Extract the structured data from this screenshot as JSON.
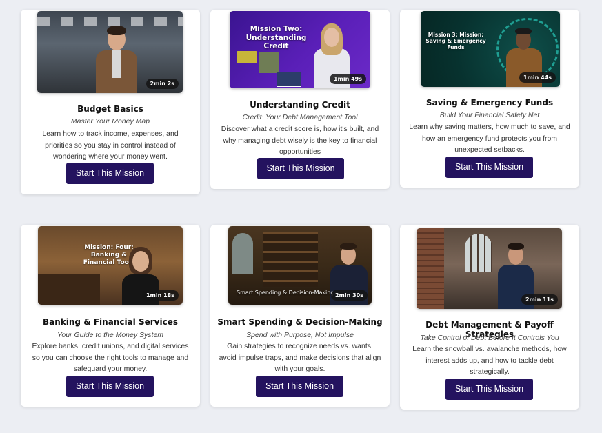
{
  "missions": [
    {
      "title": "Budget Basics",
      "subtitle": "Master Your Money Map",
      "description": "Learn how to track income, expenses, and priorities so you stay in control instead of wondering where your money went.",
      "duration": "2min 2s",
      "overlay": "",
      "button": "Start This Mission"
    },
    {
      "title": "Understanding Credit",
      "subtitle": "Credit: Your Debt Management Tool",
      "description": "Discover what a credit score is, how it's built, and why managing debt wisely is the key to financial opportunities",
      "duration": "1min 49s",
      "overlay": "Mission Two: Understanding Credit",
      "button": "Start This Mission"
    },
    {
      "title": "Saving & Emergency Funds",
      "subtitle": "Build Your Financial Safety Net",
      "description": "Learn why saving matters, how much to save, and how an emergency fund protects you from unexpected setbacks.",
      "duration": "1min 44s",
      "overlay": "Mission 3: Mission: Saving & Emergency Funds",
      "button": "Start This Mission"
    },
    {
      "title": "Banking & Financial Services",
      "subtitle": "Your Guide to the Money System",
      "description": "Explore banks, credit unions, and digital services so you can choose the right tools to manage and safeguard your money.",
      "duration": "1min 18s",
      "overlay": "Mission: Four: Banking & Financial Tools",
      "button": "Start This Mission"
    },
    {
      "title": "Smart Spending & Decision-Making",
      "subtitle": "Spend with Purpose, Not Impulse",
      "description": "Gain strategies to recognize needs vs. wants, avoid impulse traps, and make decisions that align with your goals.",
      "duration": "2min 30s",
      "overlay": "Smart Spending & Decision-Making",
      "button": "Start This Mission"
    },
    {
      "title": "Debt Management & Payoff Strategies",
      "subtitle": "Take Control of Debt Before It Controls You",
      "description": "Learn the snowball vs. avalanche methods, how interest adds up, and how to tackle debt strategically.",
      "duration": "2min 11s",
      "overlay": "",
      "button": "Start This Mission"
    }
  ]
}
